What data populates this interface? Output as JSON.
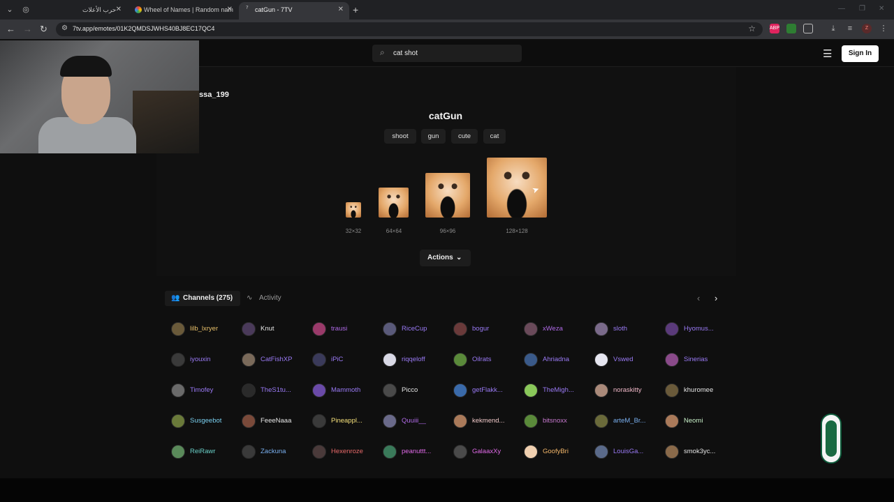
{
  "browser": {
    "tabs": [
      {
        "title": "حرب الأعلات",
        "fav_color": "#9aa0a6"
      },
      {
        "title": "Wheel of Names | Random nam",
        "fav_color": "#4285f4"
      },
      {
        "title": "catGun - 7TV",
        "fav_color": "#eeeeee"
      }
    ],
    "url": "7tv.app/emotes/01K2QMDSJWHS40BJ8EC17QC4",
    "ext_labels": [
      "ABP",
      "",
      "",
      "",
      "",
      "",
      "Z",
      ""
    ]
  },
  "header": {
    "search_value": "cat shot",
    "signin_label": "Sign In"
  },
  "emote": {
    "owner": "ssa_199",
    "title": "catGun",
    "tags": [
      "shoot",
      "gun",
      "cute",
      "cat"
    ],
    "sizes": [
      "32×32",
      "64×64",
      "96×96",
      "128×128"
    ],
    "actions_label": "Actions"
  },
  "channels_section": {
    "channels_tab": "Channels (275)",
    "activity_tab": "Activity",
    "channels": [
      {
        "name": "lilb_lxryer",
        "color": "#e8c06a",
        "avatar": "#6a5a3a"
      },
      {
        "name": "Knut",
        "color": "#e6e6e6",
        "avatar": "#4a3a5a"
      },
      {
        "name": "trausi",
        "color": "#b06ae8",
        "avatar": "#9a3a6a"
      },
      {
        "name": "RiceCup",
        "color": "#9a7af5",
        "avatar": "#5a5a7a"
      },
      {
        "name": "bogur",
        "color": "#9a7af5",
        "avatar": "#6a3a3a"
      },
      {
        "name": "xWeza",
        "color": "#b06ae8",
        "avatar": "#6a4a5a"
      },
      {
        "name": "sloth",
        "color": "#9a7af5",
        "avatar": "#7a6a8a"
      },
      {
        "name": "Hyomus...",
        "color": "#9a7af5",
        "avatar": "#5a3a7a"
      },
      {
        "name": "iyouxin",
        "color": "#9a7af5",
        "avatar": "#3a3a3a"
      },
      {
        "name": "CatFishXP",
        "color": "#9a7af5",
        "avatar": "#7a6a5a"
      },
      {
        "name": "iPiC",
        "color": "#9a7af5",
        "avatar": "#3a3a5a"
      },
      {
        "name": "riqqeloff",
        "color": "#9a7af5",
        "avatar": "#d9d9e6"
      },
      {
        "name": "Oilrats",
        "color": "#9a7af5",
        "avatar": "#5a8a3a"
      },
      {
        "name": "Ahriadna",
        "color": "#9a7af5",
        "avatar": "#3a5a8a"
      },
      {
        "name": "Vswed",
        "color": "#9a7af5",
        "avatar": "#e6e6f0"
      },
      {
        "name": "Sinerias",
        "color": "#9a7af5",
        "avatar": "#8a4a8a"
      },
      {
        "name": "Timofey",
        "color": "#9a7af5",
        "avatar": "#6a6a6a"
      },
      {
        "name": "TheS1tu...",
        "color": "#9a7af5",
        "avatar": "#2a2a2a"
      },
      {
        "name": "Mammoth",
        "color": "#9a7af5",
        "avatar": "#6a4aa8"
      },
      {
        "name": "Picco",
        "color": "#e6e6e6",
        "avatar": "#4a4a4a"
      },
      {
        "name": "getFlakk...",
        "color": "#9a7af5",
        "avatar": "#3a6aaa"
      },
      {
        "name": "TheMigh...",
        "color": "#9a7af5",
        "avatar": "#8ac85a"
      },
      {
        "name": "noraskitty",
        "color": "#f0b8c8",
        "avatar": "#aa8a7a"
      },
      {
        "name": "khuromee",
        "color": "#e6e6e6",
        "avatar": "#6a5a3a"
      },
      {
        "name": "Susgeebot",
        "color": "#7ad0f0",
        "avatar": "#6a7a3a"
      },
      {
        "name": "FeeeNaaa",
        "color": "#e6e6e6",
        "avatar": "#7a4a3a"
      },
      {
        "name": "Pineappl...",
        "color": "#f5e07a",
        "avatar": "#3a3a3a"
      },
      {
        "name": "Quuiii__",
        "color": "#b06ae8",
        "avatar": "#6a6a8a"
      },
      {
        "name": "kekmend...",
        "color": "#f0c8c8",
        "avatar": "#aa7a5a"
      },
      {
        "name": "bitsnoxx",
        "color": "#c87ad0",
        "avatar": "#5a8a3a"
      },
      {
        "name": "arteM_Br...",
        "color": "#7ab0f0",
        "avatar": "#6a6a3a"
      },
      {
        "name": "Neomi",
        "color": "#c8f0c8",
        "avatar": "#aa7a5a"
      },
      {
        "name": "ReiRawr",
        "color": "#6ad0c8",
        "avatar": "#5a8a5a"
      },
      {
        "name": "Zackuna",
        "color": "#7ab0f0",
        "avatar": "#3a3a3a"
      },
      {
        "name": "Hexenroze",
        "color": "#e86a6a",
        "avatar": "#4a3a3a"
      },
      {
        "name": "peanuttt...",
        "color": "#e06ae8",
        "avatar": "#3a7a5a"
      },
      {
        "name": "GalaaxXy",
        "color": "#e06ae8",
        "avatar": "#4a4a4a"
      },
      {
        "name": "GoofyBri",
        "color": "#f5b86a",
        "avatar": "#f0d0b0"
      },
      {
        "name": "LouisGa...",
        "color": "#9a7af5",
        "avatar": "#5a6a8a"
      },
      {
        "name": "smok3yc...",
        "color": "#e6e6e6",
        "avatar": "#8a6a4a"
      }
    ]
  }
}
